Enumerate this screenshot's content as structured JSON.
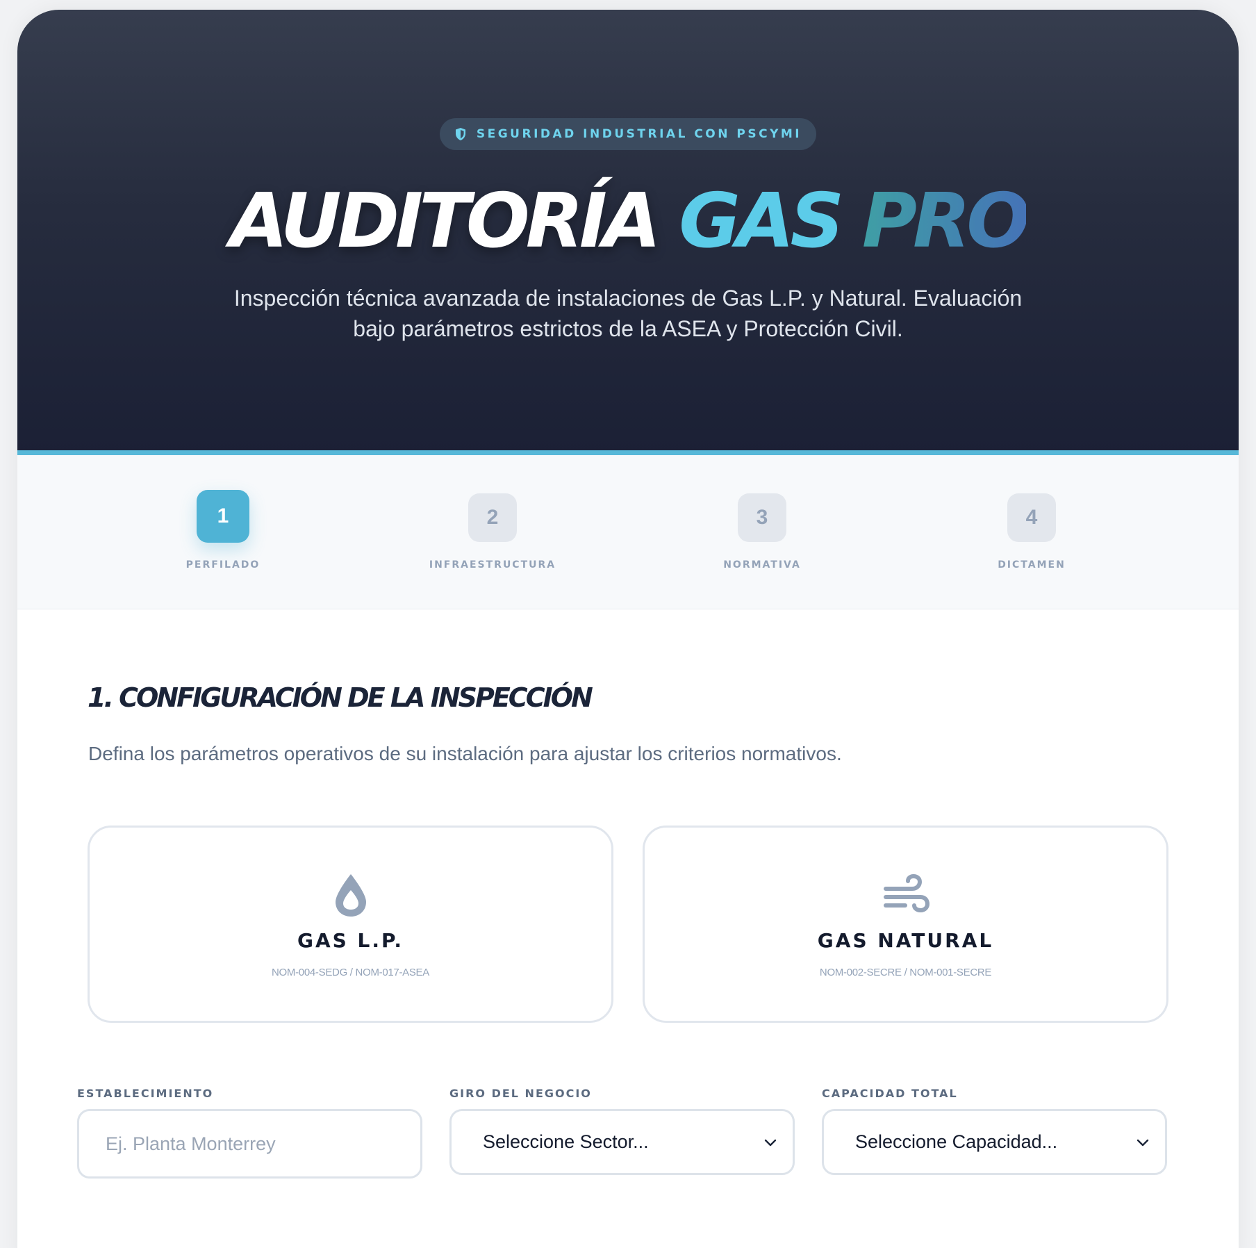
{
  "hero": {
    "badge": "SEGURIDAD INDUSTRIAL CON PSCYMI",
    "title_part1": "AUDITORÍA",
    "title_part2": "GAS",
    "title_part3": "PRO",
    "subtitle_line1": "Inspección técnica avanzada de instalaciones de Gas L.P. y Natural. Evaluación",
    "subtitle_line2": "bajo parámetros estrictos de la ASEA y Protección Civil."
  },
  "steps": [
    {
      "number": "1",
      "label": "PERFILADO",
      "active": true
    },
    {
      "number": "2",
      "label": "INFRAESTRUCTURA",
      "active": false
    },
    {
      "number": "3",
      "label": "NORMATIVA",
      "active": false
    },
    {
      "number": "4",
      "label": "DICTAMEN",
      "active": false
    }
  ],
  "section": {
    "title": "1. CONFIGURACIÓN DE LA INSPECCIÓN",
    "description": "Defina los parámetros operativos de su instalación para ajustar los criterios normativos."
  },
  "gas_options": [
    {
      "name": "GAS L.P.",
      "norms": "NOM-004-SEDG / NOM-017-ASEA",
      "icon": "droplet-icon"
    },
    {
      "name": "GAS NATURAL",
      "norms": "NOM-002-SECRE / NOM-001-SECRE",
      "icon": "wind-icon"
    }
  ],
  "form": {
    "establecimiento": {
      "label": "ESTABLECIMIENTO",
      "placeholder": "Ej. Planta Monterrey",
      "value": ""
    },
    "giro": {
      "label": "GIRO DEL NEGOCIO",
      "selected": "Seleccione Sector..."
    },
    "capacidad": {
      "label": "CAPACIDAD TOTAL",
      "selected": "Seleccione Capacidad..."
    }
  },
  "colors": {
    "accent": "#4fb3d5",
    "hero_dark": "#1b2035",
    "title_cyan": "#5ccce9"
  }
}
